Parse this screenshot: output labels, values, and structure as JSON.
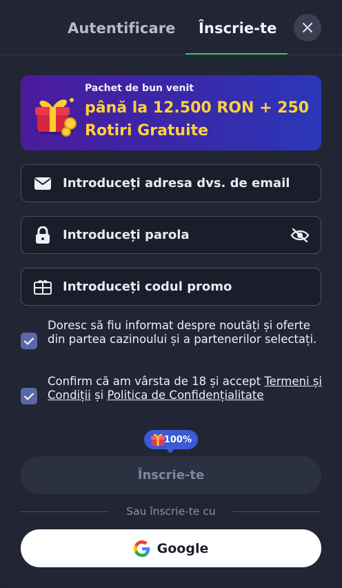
{
  "tabs": {
    "login": "Autentificare",
    "signup": "Înscrie-te"
  },
  "banner": {
    "subtitle": "Pachet de bun venit",
    "title": "până la 12.500 RON + 250 Rotiri Gratuite"
  },
  "fields": {
    "email_placeholder": "Introduceți adresa dvs. de email",
    "password_placeholder": "Introduceți parola",
    "promo_placeholder": "Introduceți codul promo"
  },
  "consents": {
    "newsletter": {
      "text": "Doresc să fiu informat despre noutăți și oferte din partea cazinoului și a partenerilor selectați.",
      "checked": true
    },
    "age": {
      "prefix": "Confirm că am vârsta de 18 și accept ",
      "terms_link": "Termeni și Condiții",
      "middle": " și ",
      "privacy_link": "Politica de Confidențialitate",
      "checked": true
    }
  },
  "bonus_badge": "100%",
  "submit_label": "Înscrie-te",
  "divider_text": "Sau înscrie-te cu",
  "google_label": "Google",
  "colors": {
    "accent_green": "#35c35b",
    "banner_title": "#ffd23a",
    "checkbox": "#5a68a8",
    "badge": "#3a5bd6"
  },
  "icons": [
    "close-icon",
    "gift-icon",
    "envelope-icon",
    "lock-icon",
    "eye-off-icon",
    "promo-gift-icon",
    "check-icon",
    "google-icon"
  ]
}
